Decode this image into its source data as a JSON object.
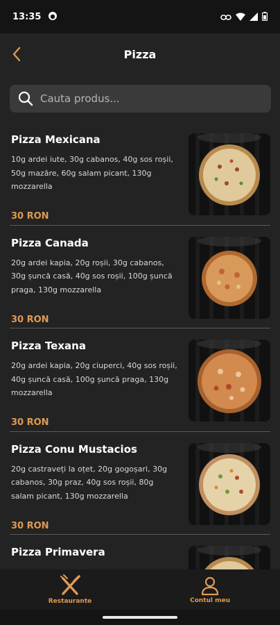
{
  "status_bar": {
    "time": "13:35"
  },
  "header": {
    "title": "Pizza"
  },
  "search": {
    "placeholder": "Cauta produs..."
  },
  "products": [
    {
      "name": "Pizza Mexicana",
      "description": "10g ardei iute, 30g cabanos, 40g sos roșii, 50g mazăre, 60g salam picant, 130g mozzarella",
      "price": "30 RON"
    },
    {
      "name": "Pizza Canada",
      "description": "20g ardei kapia, 20g roșii, 30g cabanos, 30g șuncă casă, 40g sos roșii, 100g șuncă praga, 130g mozzarella",
      "price": "30 RON"
    },
    {
      "name": "Pizza Texana",
      "description": "20g ardei kapia, 20g ciuperci, 40g sos roșii, 40g șuncă casă, 100g șuncă praga, 130g mozzarella",
      "price": "30 RON"
    },
    {
      "name": "Pizza Conu Mustacios",
      "description": "20g castraveți la oțet, 20g gogoșari, 30g cabanos, 30g praz, 40g sos roșii, 80g salam picant, 130g mozzarella",
      "price": "30 RON"
    },
    {
      "name": "Pizza Primavera",
      "description": "",
      "price": ""
    }
  ],
  "bottom_nav": [
    {
      "label": "Restaurante",
      "icon": "fork-knife-icon"
    },
    {
      "label": "Contul meu",
      "icon": "user-icon"
    }
  ],
  "colors": {
    "accent": "#e09a52",
    "background": "#232323",
    "search_bg": "#3a3a3a"
  }
}
